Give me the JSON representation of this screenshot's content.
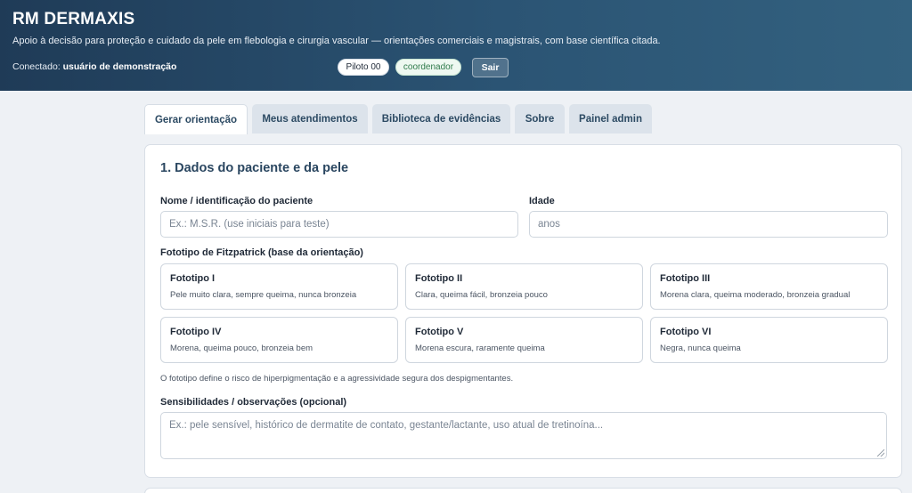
{
  "header": {
    "brand": "RM DERMAXIS",
    "tagline": "Apoio à decisão para proteção e cuidado da pele em flebologia e cirurgia vascular — orientações comerciais e magistrais, com base científica citada.",
    "connected_prefix": "Conectado:",
    "connected_user": "usuário de demonstração",
    "pilot_badge": "Piloto 00",
    "role_badge": "coordenador",
    "logout_label": "Sair"
  },
  "tabs": [
    {
      "label": "Gerar orientação",
      "active": true
    },
    {
      "label": "Meus atendimentos",
      "active": false
    },
    {
      "label": "Biblioteca de evidências",
      "active": false
    },
    {
      "label": "Sobre",
      "active": false
    },
    {
      "label": "Painel admin",
      "active": false
    }
  ],
  "section": {
    "title": "1. Dados do paciente e da pele",
    "name_label": "Nome / identificação do paciente",
    "name_placeholder": "Ex.: M.S.R. (use iniciais para teste)",
    "name_value": "",
    "age_label": "Idade",
    "age_placeholder": "anos",
    "age_value": "",
    "fitz_label": "Fototipo de Fitzpatrick (base da orientação)",
    "fototipos": [
      {
        "title": "Fototipo I",
        "desc": "Pele muito clara, sempre queima, nunca bronzeia"
      },
      {
        "title": "Fototipo II",
        "desc": "Clara, queima fácil, bronzeia pouco"
      },
      {
        "title": "Fototipo III",
        "desc": "Morena clara, queima moderado, bronzeia gradual"
      },
      {
        "title": "Fototipo IV",
        "desc": "Morena, queima pouco, bronzeia bem"
      },
      {
        "title": "Fototipo V",
        "desc": "Morena escura, raramente queima"
      },
      {
        "title": "Fototipo VI",
        "desc": "Negra, nunca queima"
      }
    ],
    "fitz_hint": "O fototipo define o risco de hiperpigmentação e a agressividade segura dos despigmentantes.",
    "sens_label": "Sensibilidades / observações (opcional)",
    "sens_placeholder": "Ex.: pele sensível, histórico de dermatite de contato, gestante/lactante, uso atual de tretinoína..."
  }
}
